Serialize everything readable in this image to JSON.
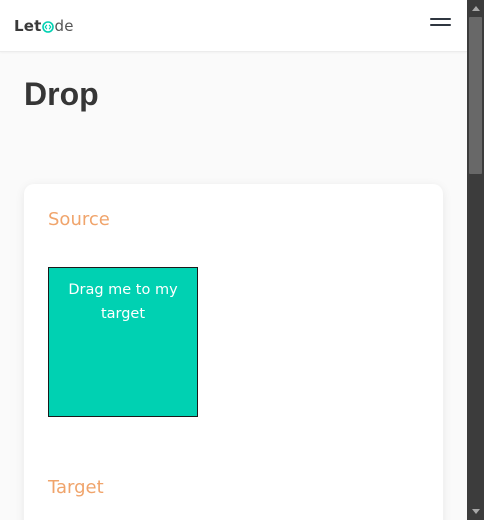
{
  "header": {
    "logo": {
      "part1": "Let",
      "part2": "de",
      "icon": "code-brackets-icon"
    },
    "menu_icon": "hamburger-menu-icon"
  },
  "page": {
    "title": "Drop"
  },
  "card": {
    "source_label": "Source",
    "draggable_text": "Drag me to my target",
    "target_label": "Target"
  },
  "colors": {
    "accent_label": "#f0a46b",
    "draggable_bg": "#00d1b2",
    "logo_accent": "#00d1b2"
  },
  "scrollbar": {
    "icon_up": "scroll-up-arrow-icon",
    "icon_down": "scroll-down-arrow-icon"
  }
}
